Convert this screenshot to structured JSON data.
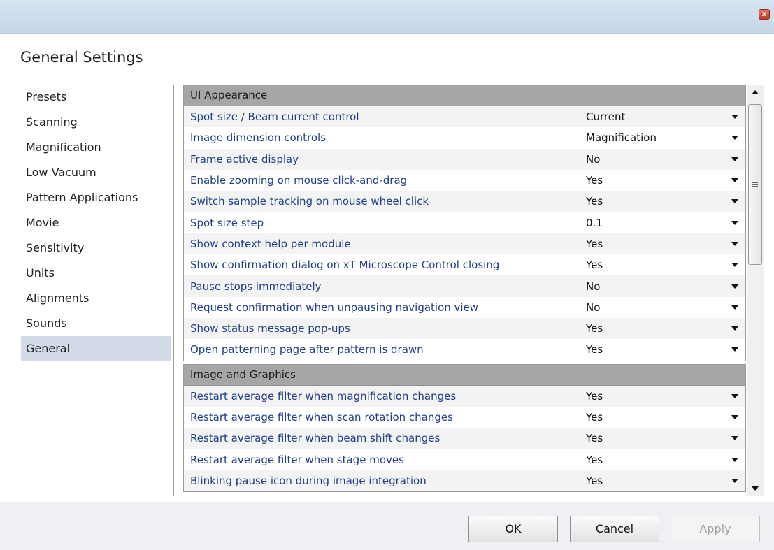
{
  "window": {
    "title": "General Settings",
    "close_glyph": "x"
  },
  "sidebar": {
    "items": [
      {
        "label": "Presets"
      },
      {
        "label": "Scanning"
      },
      {
        "label": "Magnification"
      },
      {
        "label": "Low Vacuum"
      },
      {
        "label": "Pattern Applications"
      },
      {
        "label": "Movie"
      },
      {
        "label": "Sensitivity"
      },
      {
        "label": "Units"
      },
      {
        "label": "Alignments"
      },
      {
        "label": "Sounds"
      },
      {
        "label": "General",
        "selected": true
      }
    ]
  },
  "sections": [
    {
      "header": "UI Appearance",
      "rows": [
        {
          "label": "Spot size / Beam current control",
          "value": "Current"
        },
        {
          "label": "Image dimension controls",
          "value": "Magnification"
        },
        {
          "label": "Frame active display",
          "value": "No"
        },
        {
          "label": "Enable zooming on mouse click-and-drag",
          "value": "Yes"
        },
        {
          "label": "Switch sample tracking on mouse wheel click",
          "value": "Yes"
        },
        {
          "label": "Spot size step",
          "value": "0.1"
        },
        {
          "label": "Show context help per module",
          "value": "Yes"
        },
        {
          "label": "Show confirmation dialog on xT Microscope Control closing",
          "value": "Yes"
        },
        {
          "label": "Pause stops immediately",
          "value": "No"
        },
        {
          "label": "Request confirmation when unpausing navigation view",
          "value": "No"
        },
        {
          "label": "Show status message pop-ups",
          "value": "Yes"
        },
        {
          "label": "Open patterning page after pattern is drawn",
          "value": "Yes"
        }
      ]
    },
    {
      "header": "Image and Graphics",
      "rows": [
        {
          "label": "Restart average filter when magnification changes",
          "value": "Yes"
        },
        {
          "label": "Restart average filter when scan rotation changes",
          "value": "Yes"
        },
        {
          "label": "Restart average filter when beam shift changes",
          "value": "Yes"
        },
        {
          "label": "Restart average filter when stage moves",
          "value": "Yes"
        },
        {
          "label": "Blinking pause icon during image integration",
          "value": "Yes"
        }
      ]
    }
  ],
  "footer": {
    "ok_label": "OK",
    "cancel_label": "Cancel",
    "apply_label": "Apply",
    "apply_enabled": false
  },
  "colors": {
    "label_text": "#1f3d8a",
    "section_header_bg": "#a6a6a6",
    "selected_bg": "#d3dbe8",
    "titlebar": "#c5d6ea"
  },
  "icons": [
    "close-icon",
    "dropdown-arrow-icon",
    "scroll-up-icon",
    "scroll-down-icon",
    "grip-icon"
  ]
}
